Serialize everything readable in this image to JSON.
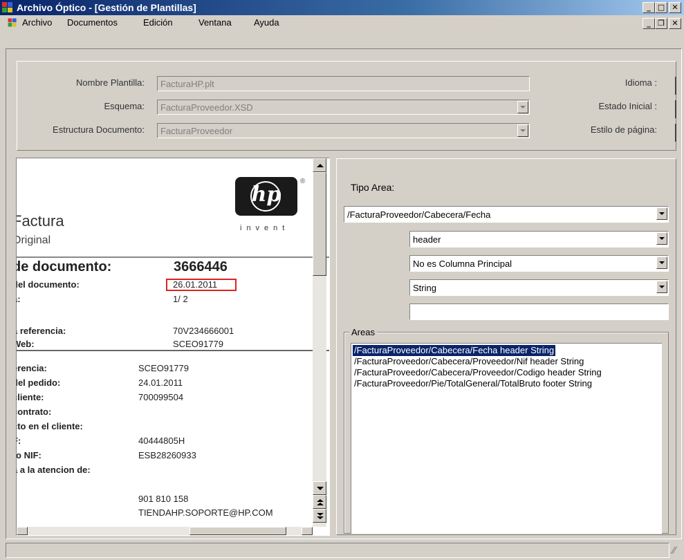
{
  "window": {
    "title": "Archivo Óptico - [Gestión de Plantillas]",
    "min_glyph": "_",
    "max_glyph": "□",
    "close_glyph": "✕",
    "restore_glyph": "❐"
  },
  "menu": {
    "items": [
      "Archivo",
      "Documentos",
      "Edición",
      "Ventana",
      "Ayuda"
    ]
  },
  "form": {
    "nombre_label": "Nombre Plantilla:",
    "nombre_value": "FacturaHP.plt",
    "esquema_label": "Esquema:",
    "esquema_value": "FacturaProveedor.XSD",
    "estructura_label": "Estructura Documento:",
    "estructura_value": "FacturaProveedor",
    "idioma_label": "Idioma :",
    "estado_label": "Estado Inicial :",
    "estilo_label": "Estilo de página:"
  },
  "document": {
    "logo_text": "hp",
    "logo_tag": "invent",
    "registered": "®",
    "title": "Factura",
    "subtitle": "Original",
    "doc_label": "de documento:",
    "doc_number": "3666446",
    "fecha_label": "del documento:",
    "fecha_value": "26.01.2011",
    "page_label": "a:",
    "page_value": "1/  2",
    "ref_label": "a referencia:",
    "ref_value": "70V234666001",
    "web_label": "Web:",
    "web_value": "SCEO91779",
    "rows": [
      {
        "label": "erencia:",
        "value": "SCEO91779"
      },
      {
        "label": "del pedido:",
        "value": "24.01.2011"
      },
      {
        "label": "cliente:",
        "value": "700099504"
      },
      {
        "label": "contrato:",
        "value": ""
      },
      {
        "label": "cto en el cliente:",
        "value": ""
      },
      {
        "label": "F:",
        "value": "40444805H"
      },
      {
        "label": "ro NIF:",
        "value": "ESB28260933"
      },
      {
        "label": "a a la atencion de:",
        "value": ""
      }
    ],
    "phone": "901 810 158",
    "email": "TIENDAHP.SOPORTE@HP.COM",
    "highlight_color": "#e02020"
  },
  "area_panel": {
    "tipo_label": "Tipo Area:",
    "tipo_value": "/FacturaProveedor/Cabecera/Fecha",
    "section_value": "header",
    "column_value": "No es Columna Principal",
    "type_value": "String",
    "text_value": "",
    "areas_label": "Areas",
    "areas": [
      "/FacturaProveedor/Cabecera/Fecha header String",
      "/FacturaProveedor/Cabecera/Proveedor/Nif header String",
      "/FacturaProveedor/Cabecera/Proveedor/Codigo header String",
      "/FacturaProveedor/Pie/TotalGeneral/TotalBruto footer String"
    ],
    "selected_color": "#0a246a"
  }
}
